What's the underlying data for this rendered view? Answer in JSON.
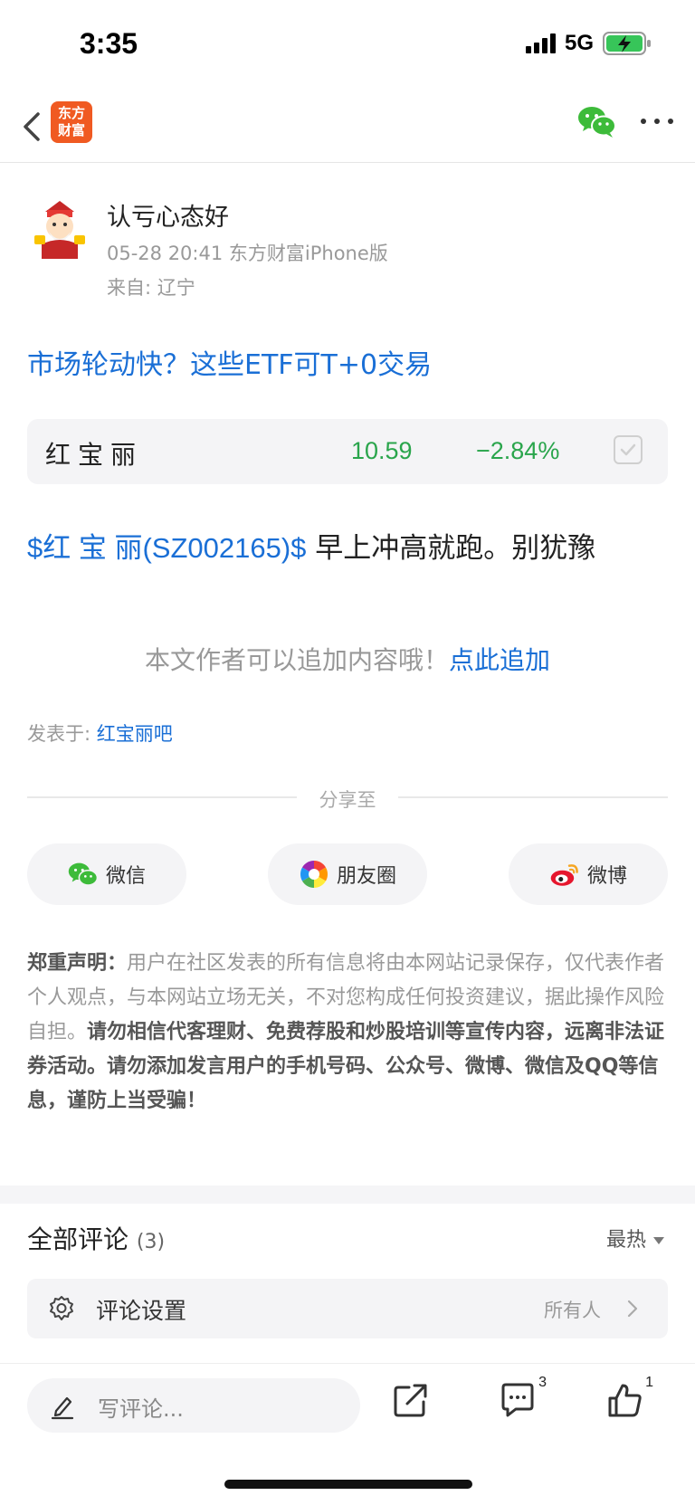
{
  "status": {
    "time": "3:35",
    "network": "5G",
    "battery_charging": true
  },
  "nav": {
    "logo_line1": "东方",
    "logo_line2": "财富",
    "icons": [
      "back-chevron-icon",
      "wechat-icon",
      "more-dots-icon"
    ]
  },
  "author": {
    "name": "认亏心态好",
    "meta": "05-28 20:41 东方财富iPhone版",
    "location": "来自: 辽宁"
  },
  "promo_link": "市场轮动快？这些ETF可T+0交易",
  "stock": {
    "name": "红宝丽",
    "price": "10.59",
    "change": "−2.84%",
    "color": "#2aa54c"
  },
  "post": {
    "tag": "$红 宝 丽(SZ002165)$",
    "text": " 早上冲高就跑。别犹豫"
  },
  "append": {
    "text": "本文作者可以追加内容哦！",
    "link": "点此追加"
  },
  "posted_in": {
    "label": "发表于: ",
    "bar": "红宝丽吧"
  },
  "share": {
    "label": "分享至",
    "buttons": [
      {
        "label": "微信",
        "icon": "wechat-icon"
      },
      {
        "label": "朋友圈",
        "icon": "moments-icon"
      },
      {
        "label": "微博",
        "icon": "weibo-icon"
      }
    ]
  },
  "disclaimer": {
    "title": "郑重声明：",
    "part1": "用户在社区发表的所有信息将由本网站记录保存，仅代表作者个人观点，与本网站立场无关，不对您构成任何投资建议，据此操作风险自担。",
    "part2": "请勿相信代客理财、免费荐股和炒股培训等宣传内容，远离非法证券活动。请勿添加发言用户的手机号码、公众号、微博、微信及QQ等信息，谨防上当受骗！"
  },
  "comments": {
    "title": "全部评论",
    "count": "(3)",
    "sort": "最热"
  },
  "comment_settings": {
    "label": "评论设置",
    "value": "所有人"
  },
  "bottom": {
    "placeholder": "写评论...",
    "comment_count": "3",
    "like_count": "1"
  },
  "colors": {
    "link": "#1a6fd6",
    "brand": "#f05a22",
    "stock_down": "#2aa54c"
  }
}
